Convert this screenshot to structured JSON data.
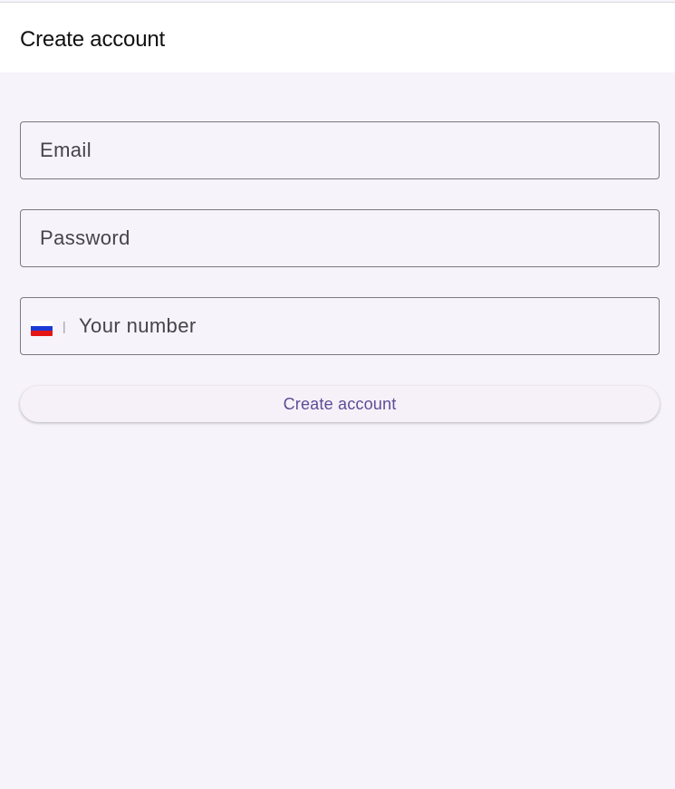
{
  "app_bar": {
    "title": "Create account"
  },
  "form": {
    "email": {
      "placeholder": "Email",
      "value": ""
    },
    "password": {
      "placeholder": "Password",
      "value": ""
    },
    "phone": {
      "placeholder": "Your number",
      "value": "",
      "country_flag_icon": "russia-flag-icon",
      "divider": "|"
    },
    "submit_label": "Create account"
  },
  "colors": {
    "background": "#f6f4fa",
    "app_bar": "#ffffff",
    "field_border": "#7a7880",
    "button_bg": "#f6f1f8",
    "button_text": "#5f4b96"
  }
}
